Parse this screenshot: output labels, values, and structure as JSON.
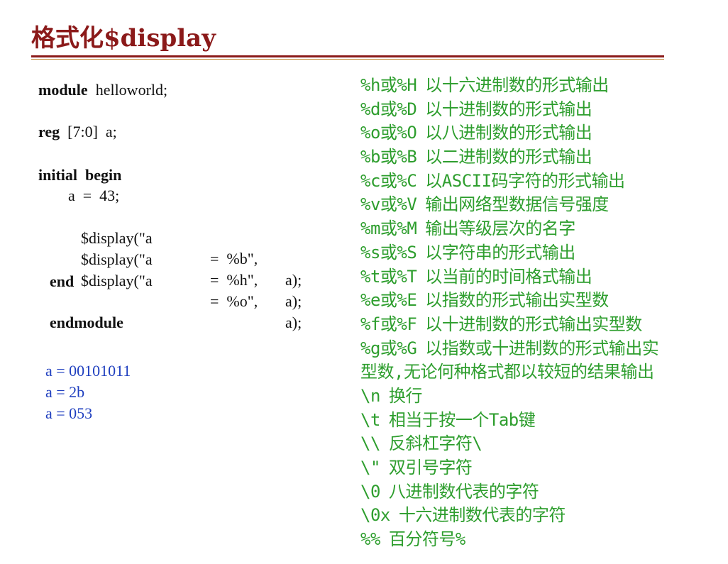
{
  "title": "格式化$display",
  "code": {
    "module_kw": "module",
    "module_name": "helloworld;",
    "reg_kw": "reg",
    "reg_decl": "[7:0]  a;",
    "initial_kw": "initial  begin",
    "assign": "a  =  43;",
    "display_lines": [
      {
        "call": "$display(\"a",
        "eq": "=  %b\",",
        "arg": "a);"
      },
      {
        "call": "$display(\"a",
        "eq": "=  %h\",",
        "arg": "a);"
      },
      {
        "call": "$display(\"a",
        "eq": "=  %o\",",
        "arg": "a);"
      }
    ],
    "end_kw": "end",
    "endmodule_kw": "endmodule"
  },
  "output": [
    "a = 00101011",
    "a = 2b",
    "a = 053"
  ],
  "formats": [
    {
      "spec": "%h或%H",
      "desc": "以十六进制数的形式输出"
    },
    {
      "spec": "%d或%D",
      "desc": "以十进制数的形式输出"
    },
    {
      "spec": "%o或%O",
      "desc": "以八进制数的形式输出"
    },
    {
      "spec": "%b或%B",
      "desc": "以二进制数的形式输出"
    },
    {
      "spec": "%c或%C",
      "desc": "以ASCII码字符的形式输出"
    },
    {
      "spec": "%v或%V",
      "desc": "输出网络型数据信号强度"
    },
    {
      "spec": "%m或%M",
      "desc": "输出等级层次的名字"
    },
    {
      "spec": "%s或%S",
      "desc": "以字符串的形式输出"
    },
    {
      "spec": "%t或%T",
      "desc": "以当前的时间格式输出"
    },
    {
      "spec": "%e或%E",
      "desc": "以指数的形式输出实型数"
    },
    {
      "spec": "%f或%F",
      "desc": "以十进制数的形式输出实型数"
    },
    {
      "spec": "%g或%G",
      "desc": "以指数或十进制数的形式输出实"
    },
    {
      "spec": "",
      "desc": "型数,无论何种格式都以较短的结果输出"
    },
    {
      "spec": "\\n",
      "desc": "换行"
    },
    {
      "spec": "\\t",
      "desc": "相当于按一个Tab键"
    },
    {
      "spec": "\\\\",
      "desc": "反斜杠字符\\"
    },
    {
      "spec": "\\\"",
      "desc": "双引号字符"
    },
    {
      "spec": "\\0",
      "desc": "八进制数代表的字符"
    },
    {
      "spec": "\\0x",
      "desc": "十六进制数代表的字符"
    },
    {
      "spec": "%%",
      "desc": "百分符号%"
    }
  ],
  "colors": {
    "title": "#8b1a1a",
    "code": "#111111",
    "output": "#1f3fbf",
    "formats": "#2e9e2e"
  }
}
